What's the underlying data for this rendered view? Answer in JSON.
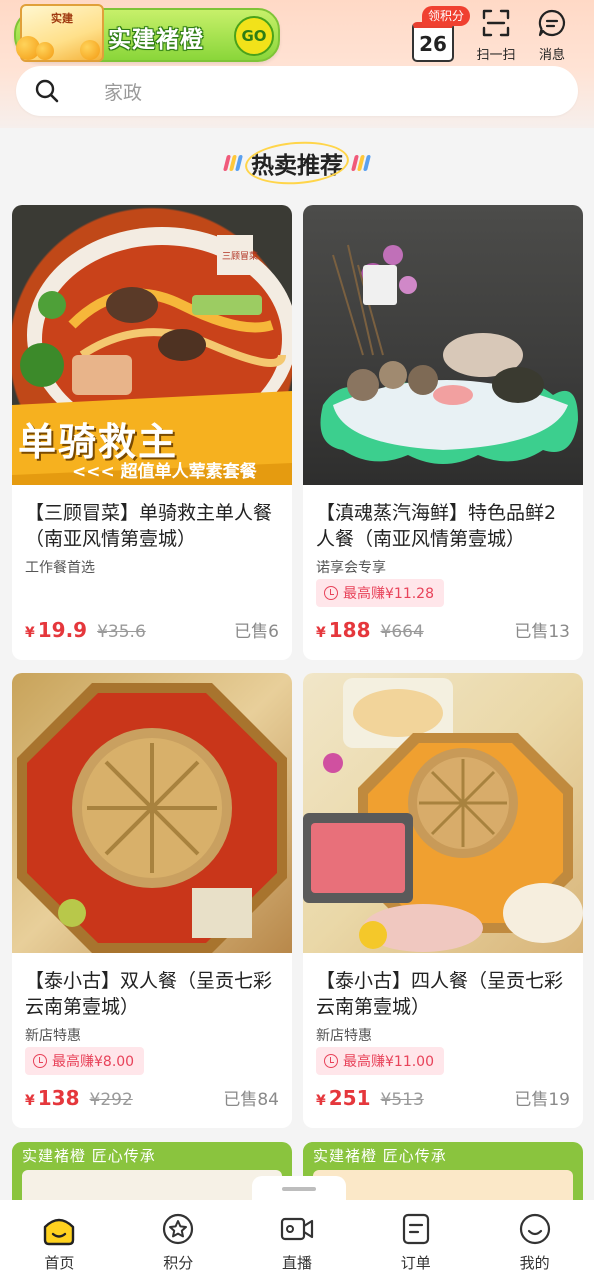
{
  "header": {
    "banner": {
      "title": "实建褚橙",
      "go": "GO",
      "box_label": "实建"
    },
    "points": {
      "tag": "领积分",
      "day": "26"
    },
    "scan_label": "扫一扫",
    "messages_label": "消息"
  },
  "search": {
    "placeholder": "家政"
  },
  "section": {
    "title": "热卖推荐"
  },
  "products": [
    {
      "title": "【三顾冒菜】单骑救主单人餐（南亚风情第壹城）",
      "subtitle": "工作餐首选",
      "earn": "",
      "currency": "¥",
      "price": "19.9",
      "original_price": "¥35.6",
      "sold": "已售6",
      "image_title": "单骑救主",
      "image_subtitle": "<<< 超值单人荤素套餐",
      "image_brand": "三顾冒菜"
    },
    {
      "title": "【滇魂蒸汽海鲜】特色品鲜2人餐（南亚风情第壹城）",
      "subtitle": "诺享会专享",
      "earn": "最高赚¥11.28",
      "currency": "¥",
      "price": "188",
      "original_price": "¥664",
      "sold": "已售13"
    },
    {
      "title": "【泰小古】双人餐（呈贡七彩云南第壹城）",
      "subtitle": "新店特惠",
      "earn": "最高赚¥8.00",
      "currency": "¥",
      "price": "138",
      "original_price": "¥292",
      "sold": "已售84"
    },
    {
      "title": "【泰小古】四人餐（呈贡七彩云南第壹城）",
      "subtitle": "新店特惠",
      "earn": "最高赚¥11.00",
      "currency": "¥",
      "price": "251",
      "original_price": "¥513",
      "sold": "已售19"
    }
  ],
  "partial_cards": [
    {
      "label": "实建褚橙 匠心传承"
    },
    {
      "label": "实建褚橙 匠心传承"
    }
  ],
  "nav": [
    {
      "label": "首页",
      "icon": "home-icon",
      "active": true
    },
    {
      "label": "积分",
      "icon": "points-star-icon",
      "active": false
    },
    {
      "label": "直播",
      "icon": "live-video-icon",
      "active": false
    },
    {
      "label": "订单",
      "icon": "order-icon",
      "active": false
    },
    {
      "label": "我的",
      "icon": "profile-smile-icon",
      "active": false
    }
  ],
  "colors": {
    "accent_red": "#e5373c",
    "earn_pink": "#e8435a",
    "brand_green": "#8ac43e",
    "nav_active_yellow": "#ffd21f"
  }
}
